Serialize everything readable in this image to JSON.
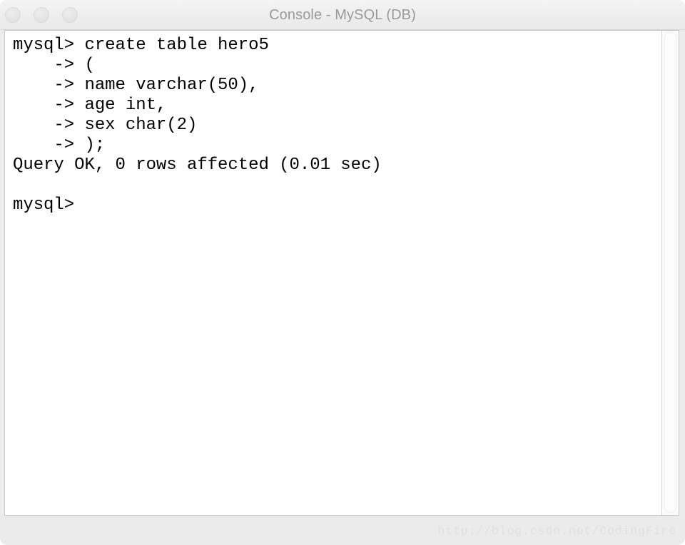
{
  "window": {
    "title": "Console - MySQL (DB)",
    "traffic_lights": [
      {
        "name": "close",
        "color": "#e2e2e2"
      },
      {
        "name": "minimize",
        "color": "#e2e2e2"
      },
      {
        "name": "maximize",
        "color": "#e2e2e2"
      }
    ]
  },
  "console": {
    "lines": [
      "mysql> create table hero5",
      "    -> (",
      "    -> name varchar(50),",
      "    -> age int,",
      "    -> sex char(2)",
      "    -> );",
      "Query OK, 0 rows affected (0.01 sec)",
      "",
      "mysql> "
    ],
    "text": "mysql> create table hero5\n    -> (\n    -> name varchar(50),\n    -> age int,\n    -> sex char(2)\n    -> );\nQuery OK, 0 rows affected (0.01 sec)\n\nmysql> ",
    "prompt": "mysql>",
    "status_message": "Query OK, 0 rows affected (0.01 sec)",
    "text_color": "#000000",
    "background_color": "#ffffff"
  },
  "footer": {
    "watermark": "http://blog.csdn.net/CodingFire"
  }
}
